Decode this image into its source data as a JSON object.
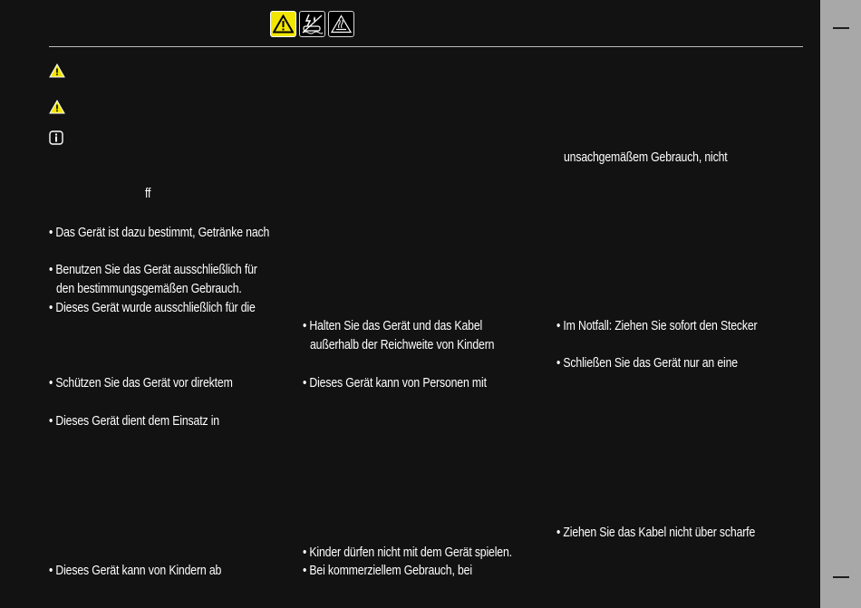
{
  "lines": {
    "l1": "unsachgemäßem Gebrauch,  nicht",
    "l2": "ff",
    "l3": "• Das Gerät ist dazu bestimmt, Getränke nach",
    "l4": "• Benutzen Sie das Gerät ausschließlich für",
    "l5": "den bestimmungsgemäßen Gebrauch.",
    "l6": "• Dieses Gerät wurde ausschließlich für die",
    "l7": "• Halten Sie das Gerät und das Kabel",
    "l8": "außerhalb der Reichweite von Kindern",
    "l9": "• Im Notfall: Ziehen Sie sofort den Stecker",
    "l10": "• Schließen Sie das Gerät nur an eine",
    "l11": "• Schützen Sie das Gerät vor direktem",
    "l12": "• Dieses Gerät kann von Personen mit",
    "l13": "• Dieses Gerät dient dem Einsatz in",
    "l14": "• Ziehen Sie das Kabel nicht über scharfe",
    "l15": "• Kinder dürfen nicht mit dem Gerät spielen.",
    "l16": "• Dieses Gerät kann von Kindern ab",
    "l17": "• Bei kommerziellem Gebrauch, bei"
  },
  "icons": {
    "header": [
      "warning-yellow-icon",
      "electric-water-hazard-icon",
      "hot-surface-icon"
    ],
    "margin": [
      "warning-icon",
      "caution-icon",
      "info-icon"
    ]
  },
  "colors": {
    "background": "#121212",
    "sidebar": "#a8a8a8",
    "text": "#ffffff",
    "warning_yellow": "#f2e600"
  }
}
